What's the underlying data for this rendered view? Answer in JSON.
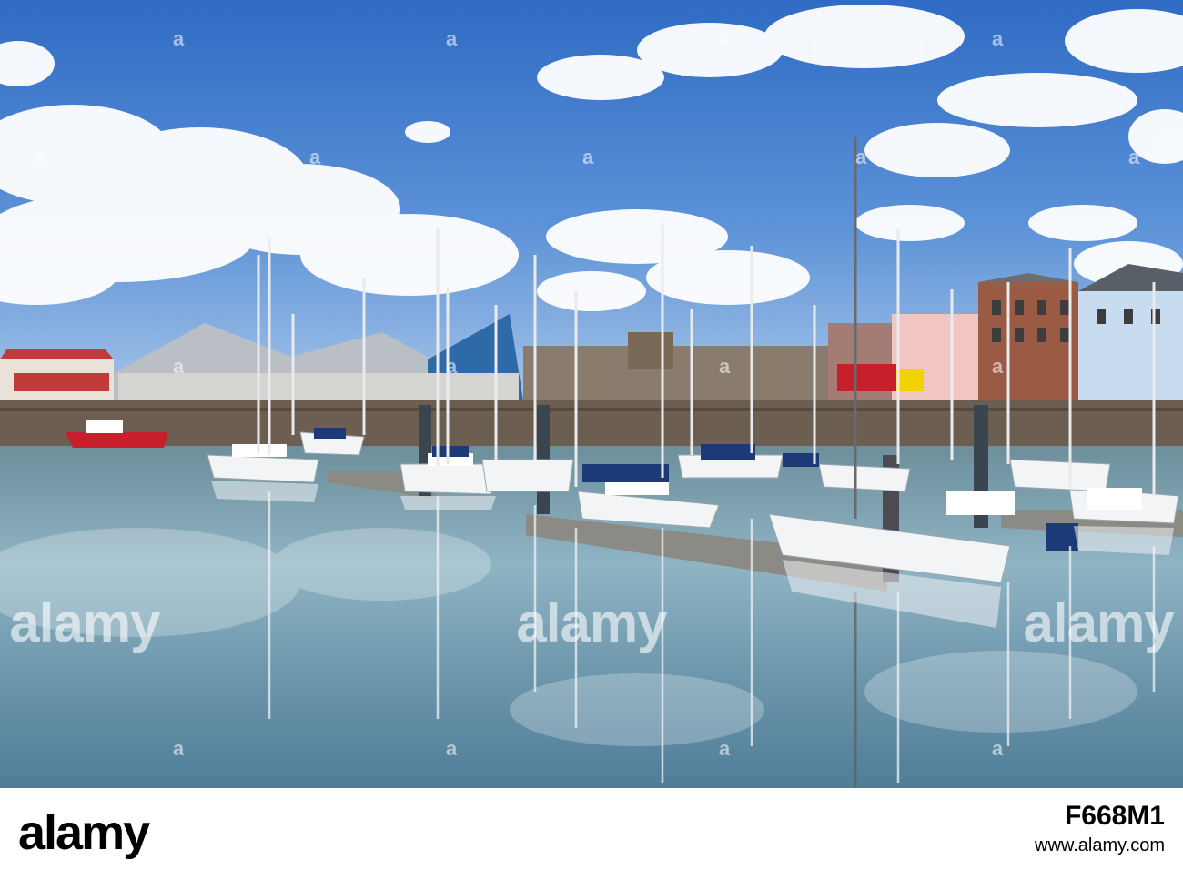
{
  "watermark": {
    "brand": "alamy",
    "image_id": "F668M1",
    "url": "www.alamy.com"
  },
  "colors": {
    "sky_top": "#3a73c8",
    "sky_bottom": "#9cc0e6",
    "water": "#7aa0b0",
    "hull_red": "#c8202a",
    "boat_white": "#f2f4f6",
    "navy": "#1d3a78"
  },
  "scene": {
    "description_icons": [
      "cloud-icon",
      "sailboat-icon",
      "building-icon"
    ]
  }
}
